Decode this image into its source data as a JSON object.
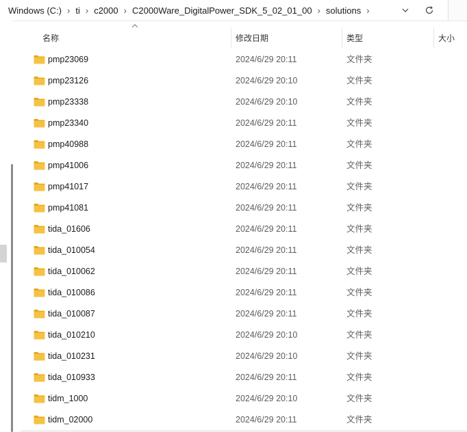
{
  "address": {
    "crumbs": [
      "Windows (C:)",
      "ti",
      "c2000",
      "C2000Ware_DigitalPower_SDK_5_02_01_00",
      "solutions"
    ]
  },
  "columns": {
    "name": "名称",
    "date": "修改日期",
    "type": "类型",
    "size": "大小"
  },
  "files": [
    {
      "name": "pmp23069",
      "date": "2024/6/29 20:11",
      "type": "文件夹"
    },
    {
      "name": "pmp23126",
      "date": "2024/6/29 20:10",
      "type": "文件夹"
    },
    {
      "name": "pmp23338",
      "date": "2024/6/29 20:10",
      "type": "文件夹"
    },
    {
      "name": "pmp23340",
      "date": "2024/6/29 20:11",
      "type": "文件夹"
    },
    {
      "name": "pmp40988",
      "date": "2024/6/29 20:11",
      "type": "文件夹"
    },
    {
      "name": "pmp41006",
      "date": "2024/6/29 20:11",
      "type": "文件夹"
    },
    {
      "name": "pmp41017",
      "date": "2024/6/29 20:11",
      "type": "文件夹"
    },
    {
      "name": "pmp41081",
      "date": "2024/6/29 20:11",
      "type": "文件夹"
    },
    {
      "name": "tida_01606",
      "date": "2024/6/29 20:11",
      "type": "文件夹"
    },
    {
      "name": "tida_010054",
      "date": "2024/6/29 20:11",
      "type": "文件夹"
    },
    {
      "name": "tida_010062",
      "date": "2024/6/29 20:11",
      "type": "文件夹"
    },
    {
      "name": "tida_010086",
      "date": "2024/6/29 20:11",
      "type": "文件夹"
    },
    {
      "name": "tida_010087",
      "date": "2024/6/29 20:11",
      "type": "文件夹"
    },
    {
      "name": "tida_010210",
      "date": "2024/6/29 20:10",
      "type": "文件夹"
    },
    {
      "name": "tida_010231",
      "date": "2024/6/29 20:10",
      "type": "文件夹"
    },
    {
      "name": "tida_010933",
      "date": "2024/6/29 20:11",
      "type": "文件夹"
    },
    {
      "name": "tidm_1000",
      "date": "2024/6/29 20:10",
      "type": "文件夹"
    },
    {
      "name": "tidm_02000",
      "date": "2024/6/29 20:11",
      "type": "文件夹"
    }
  ],
  "icons": {
    "separator": "chevron-right-icon",
    "dropdown": "chevron-down-icon",
    "refresh": "refresh-icon",
    "search": "search-icon",
    "folder": "folder-icon",
    "sort": "sort-ascending-icon"
  },
  "colors": {
    "folder_fill": "#F5C244",
    "folder_tab": "#E8A817",
    "scrollbar": "#8A8A8A"
  }
}
